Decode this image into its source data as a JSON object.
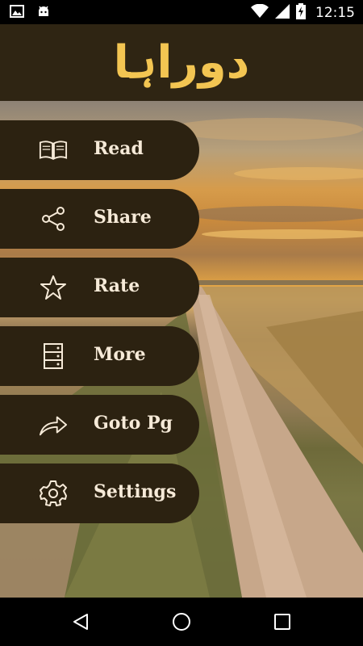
{
  "status_bar": {
    "time": "12:15",
    "icons": [
      "image-notification-icon",
      "android-notification-icon",
      "wifi-icon",
      "signal-icon",
      "battery-charging-icon"
    ]
  },
  "header": {
    "title": "دوراہا"
  },
  "menu": {
    "items": [
      {
        "label": "Read",
        "icon": "book-icon"
      },
      {
        "label": "Share",
        "icon": "share-icon"
      },
      {
        "label": "Rate",
        "icon": "star-icon"
      },
      {
        "label": "More",
        "icon": "list-icon"
      },
      {
        "label": "Goto Pg",
        "icon": "forward-arrow-icon"
      },
      {
        "label": "Settings",
        "icon": "gear-icon"
      }
    ]
  },
  "nav_bar": {
    "buttons": [
      "back-icon",
      "home-icon",
      "recents-icon"
    ]
  },
  "colors": {
    "header_bg": "#2f2513",
    "title": "#f3c552",
    "menu_bg": "#2c2211",
    "menu_text": "#f6ead8"
  }
}
